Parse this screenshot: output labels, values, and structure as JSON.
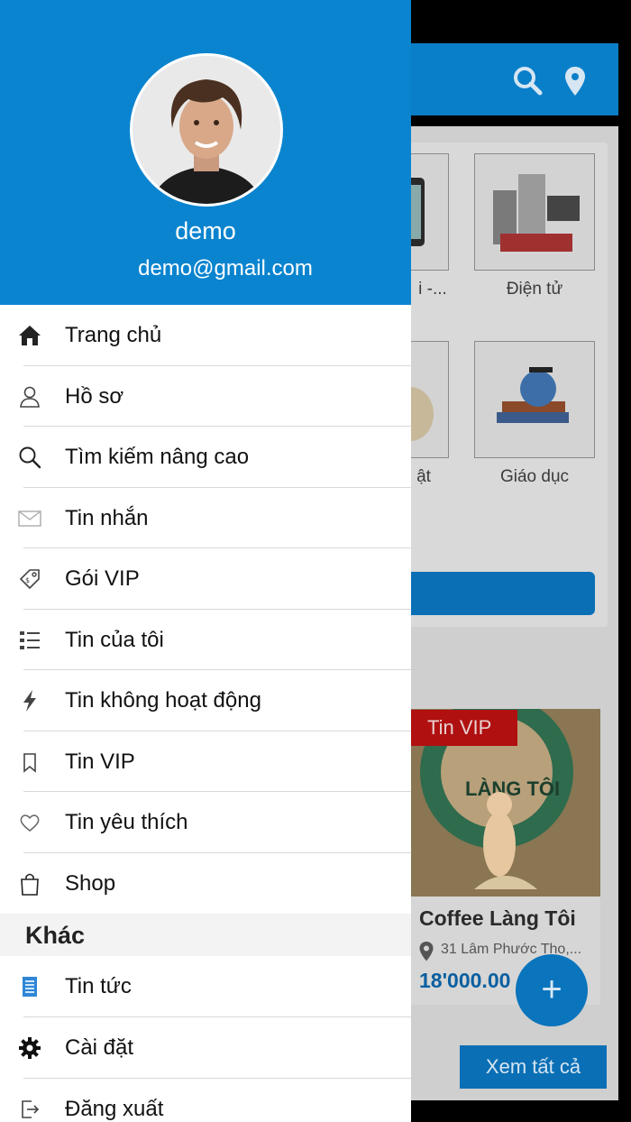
{
  "background": {
    "categories": [
      {
        "label": "i -..."
      },
      {
        "label": "Điện tử"
      },
      {
        "label": "ật"
      },
      {
        "label": "Giáo dục"
      }
    ],
    "vip_card": {
      "badge": "Tin VIP",
      "title": "Coffee Làng Tôi",
      "address": "31 Lâm Phước Tho,...",
      "price": "18'000.00",
      "sign_text": "LÀNG TÔI"
    },
    "fab_label": "+",
    "see_all_label": "Xem tất cả",
    "colors": {
      "accent": "#0a84cf",
      "vip_badge": "#b01010"
    }
  },
  "drawer": {
    "user": {
      "name": "demo",
      "email": "demo@gmail.com"
    },
    "menu": [
      {
        "label": "Trang chủ",
        "icon": "home-icon"
      },
      {
        "label": "Hồ sơ",
        "icon": "user-icon"
      },
      {
        "label": "Tìm kiếm nâng cao",
        "icon": "search-icon"
      },
      {
        "label": "Tin nhắn",
        "icon": "mail-icon"
      },
      {
        "label": "Gói VIP",
        "icon": "tag-icon"
      },
      {
        "label": "Tin của tôi",
        "icon": "list-icon"
      },
      {
        "label": "Tin không hoạt động",
        "icon": "bolt-icon"
      },
      {
        "label": "Tin VIP",
        "icon": "bookmark-icon"
      },
      {
        "label": "Tin yêu thích",
        "icon": "heart-icon"
      },
      {
        "label": "Shop",
        "icon": "shopping-bag-icon"
      }
    ],
    "section_title": "Khác",
    "menu_other": [
      {
        "label": "Tin tức",
        "icon": "news-icon"
      },
      {
        "label": "Cài đặt",
        "icon": "gear-icon"
      },
      {
        "label": "Đăng xuất",
        "icon": "logout-icon"
      }
    ]
  }
}
